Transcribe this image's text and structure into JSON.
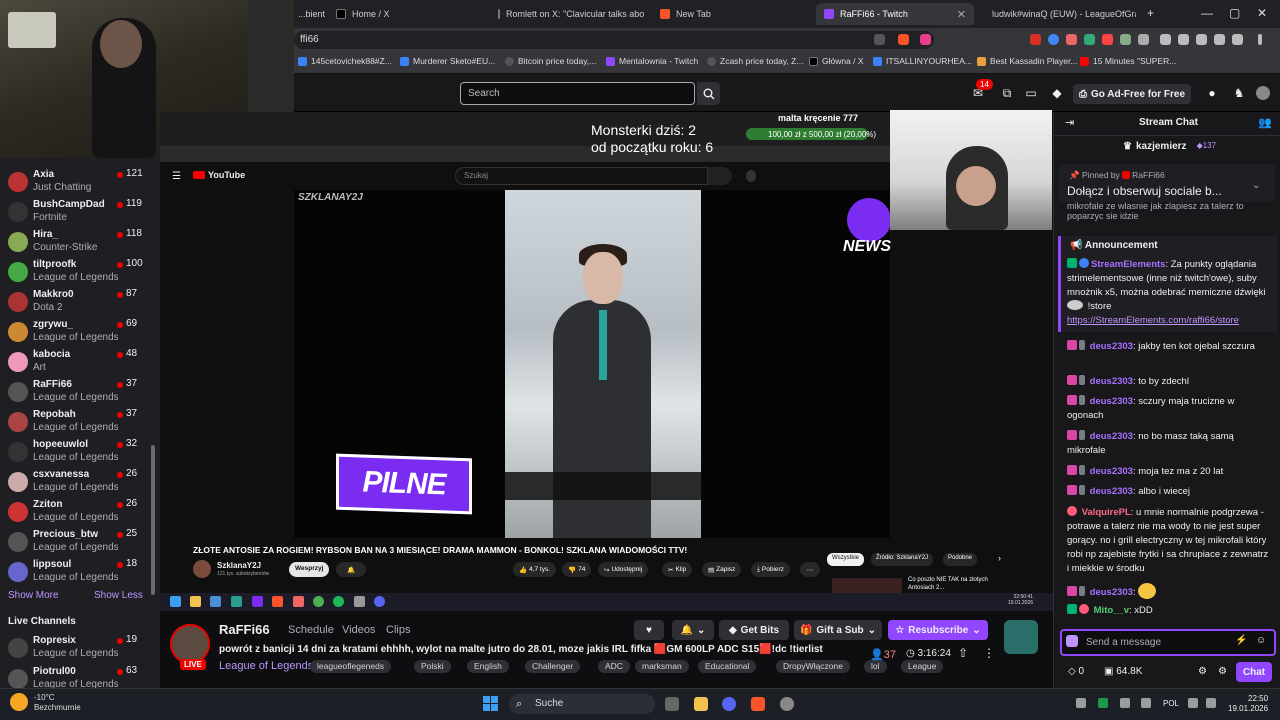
{
  "browser": {
    "tabs": [
      {
        "label": "...bient"
      },
      {
        "label": "Home / X"
      },
      {
        "label": "Romlett on X: \"Clavicular talks about"
      },
      {
        "label": "New Tab"
      },
      {
        "label": "RaFFi66 - Twitch"
      },
      {
        "label": "ludwik#winaQ (EUW) - LeagueOfGra"
      }
    ],
    "url": "ffi66",
    "bookmarks": [
      "145cetovichek88#Z...",
      "Murderer Sketo#EU...",
      "Bitcoin price today,...",
      "Mentalownia - Twitch",
      "Zcash price today, Z...",
      "Główna / X",
      "ITSALLINYOURHEA...",
      "Best Kassadin Player...",
      "15 Minutes \"SUPER..."
    ]
  },
  "twitch_nav": {
    "search_placeholder": "Search",
    "notifications_count": "14",
    "ad_free_label": "Go Ad-Free for Free"
  },
  "sidebar": {
    "channels": [
      {
        "name": "Axia",
        "category": "Just Chatting",
        "viewers": "121",
        "color": "#b33"
      },
      {
        "name": "BushCampDad",
        "category": "Fortnite",
        "viewers": "119",
        "color": "#333"
      },
      {
        "name": "Hira_",
        "category": "Counter-Strike",
        "viewers": "118",
        "color": "#8a5"
      },
      {
        "name": "tiltproofk",
        "category": "League of Legends",
        "viewers": "100",
        "color": "#4a4"
      },
      {
        "name": "Makkro0",
        "category": "Dota 2",
        "viewers": "87",
        "color": "#a33"
      },
      {
        "name": "zgrywu_",
        "category": "League of Legends",
        "viewers": "69",
        "color": "#c83"
      },
      {
        "name": "kabocia",
        "category": "Art",
        "viewers": "48",
        "color": "#e9b"
      },
      {
        "name": "RaFFi66",
        "category": "League of Legends",
        "viewers": "37",
        "color": "#555"
      },
      {
        "name": "Repobah",
        "category": "League of Legends",
        "viewers": "37",
        "color": "#a44"
      },
      {
        "name": "hopeeuwlol",
        "category": "League of Legends",
        "viewers": "32",
        "color": "#333"
      },
      {
        "name": "csxvanessa",
        "category": "League of Legends",
        "viewers": "26",
        "color": "#caa"
      },
      {
        "name": "Zziton",
        "category": "League of Legends",
        "viewers": "26",
        "color": "#c33"
      },
      {
        "name": "Precious_btw",
        "category": "League of Legends",
        "viewers": "25",
        "color": "#555"
      },
      {
        "name": "lippsoul",
        "category": "League of Legends",
        "viewers": "18",
        "color": "#66c"
      }
    ],
    "show_more": "Show More",
    "show_less": "Show Less",
    "live_channels_heading": "Live Channels",
    "live_channels": [
      {
        "name": "Ropresix",
        "category": "League of Legends",
        "viewers": "19",
        "color": "#444"
      },
      {
        "name": "Piotrul00",
        "category": "League of Legends",
        "viewers": "63",
        "color": "#555"
      }
    ]
  },
  "player": {
    "overlay_line1": "Monsterki dziś: 2",
    "overlay_line2": "od początku roku: 6",
    "wheel_label": "malta kręcenie 777",
    "wheel_progress": "100,00 zł z 500,00 zł (20,00%)",
    "youtube": {
      "search_placeholder": "Szukaj",
      "watermark": "SZKLANAY2J",
      "badge_text": "PILNE",
      "news_text": "NEWS",
      "video_title": "ZŁOTE ANTOSIE ZA ROGIEM! RYBSON BAN NA 3 MIESIĄCE! DRAMA MAMMON - BONKOL! SZKLANA WIADOMOŚCI TTV!",
      "channel_name": "SzklanaY2J",
      "subscribers": "121 tys. subskrybentów",
      "support_label": "Wesprzyj",
      "likes": "4,7 tys.",
      "comments": "74",
      "share": "Udostępnij",
      "clip": "Klip",
      "save": "Zapisz",
      "download": "Pobierz",
      "chips": [
        "Wszystkie",
        "Źródło: SzklanaY2J",
        "Podobne"
      ],
      "side_title": "Co poszło NIE TAK na złotych Antosiach 2..."
    },
    "clock": {
      "time": "22:50:41",
      "date": "19.01.2026"
    }
  },
  "stream_info": {
    "live": "LIVE",
    "streamer": "RaFFi66",
    "tabs": [
      "Schedule",
      "Videos",
      "Clips"
    ],
    "title": "powrót z banicji 14 dni za kratami ehhhh, wylot na malte jutro do 28.01, moze jakis IRL fifka 🟥GM 600LP ADC S15🟥!dc !tierlist",
    "game": "League of Legends",
    "tags": [
      "leagueoflegeneds",
      "Polski",
      "English",
      "Challenger",
      "ADC",
      "marksman",
      "Educational",
      "DropyWłączone",
      "lol",
      "League"
    ],
    "get_bits": "Get Bits",
    "gift_sub": "Gift a Sub",
    "resubscribe": "Resubscribe",
    "viewers": "37",
    "uptime": "3:16:24"
  },
  "chat": {
    "title": "Stream Chat",
    "leader_name": "kazjemierz",
    "leader_bits": "137",
    "pinned_by_label": "Pinned by",
    "pinned_by_user": "RaFFi66",
    "pinned_message": "Dołącz i obserwuj sociale b...",
    "pinned_bg_text": "mikrofale ze wlasnie jak zlapiesz za talerz to poparzyc sie idzie",
    "announcement_label": "Announcement",
    "announcement": {
      "user": "StreamElements",
      "text": "Za punkty oglądania strimelementsowe (inne niż twitch'owe), suby mnożnik x5, można odebrać memiczne dźwięki",
      "text_after_emote": "!store",
      "link": "https://StreamElements.com/raffi66/store"
    },
    "messages": [
      {
        "user": "deus2303",
        "text": "jakby ten kot ojebal szczura"
      },
      {
        "user": "deus2303",
        "text": "to by zdechl"
      },
      {
        "user": "deus2303",
        "text": "sczury maja trucizne w ogonach"
      },
      {
        "user": "deus2303",
        "text": "no bo masz taką samą mikrofale"
      },
      {
        "user": "deus2303",
        "text": "moja tez ma z 20 lat"
      },
      {
        "user": "deus2303",
        "text": "albo i wiecej"
      },
      {
        "user": "ValquirePL",
        "text": "u mnie normalnie podgrzewa - potrawe a talerz nie ma wody to nie jest super gorący. no i grill electryczny w tej mikrofali który robi np zajebiste frytki i sa chrupiace z zewnatrz i miekkie w środku"
      },
      {
        "user": "deus2303",
        "text": ""
      },
      {
        "user": "Mito__v",
        "text": "xDD"
      }
    ],
    "input_placeholder": "Send a message",
    "points": "0",
    "bits": "64.8K",
    "chat_button": "Chat"
  },
  "taskbar": {
    "temperature": "-10°C",
    "weather": "Bezchmurnie",
    "search_placeholder": "Suche",
    "language": "POL",
    "time": "22:50",
    "date": "19.01.2026"
  }
}
